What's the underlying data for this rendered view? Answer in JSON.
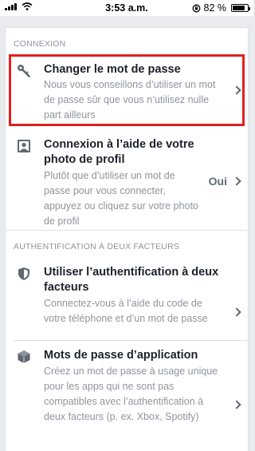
{
  "status_bar": {
    "time": "3:53 a.m.",
    "battery": "82 %",
    "battery_level": 0.82
  },
  "login_section": {
    "header": "CONNEXION",
    "change_password": {
      "title": "Changer le mot de passe",
      "description": "Nous vous conseillons d’utiliser un mot de passe sûr que vous n’utilisez nulle part ailleurs",
      "icon": "key-icon"
    },
    "profile_photo_login": {
      "title": "Connexion à l’aide de votre photo de profil",
      "description": "Plutôt que d’utiliser un mot de passe pour vous connecter, appuyez ou cliquez sur votre photo de profil",
      "value": "Oui",
      "icon": "profile-photo-icon"
    }
  },
  "two_factor_section": {
    "header": "AUTHENTIFICATION À DEUX FACTEURS",
    "use_two_factor": {
      "title": "Utiliser l’authentification à deux facteurs",
      "description": "Connectez-vous à l’aide du code de votre téléphone et d’un mot de passe",
      "icon": "shield-icon"
    },
    "app_passwords": {
      "title": "Mots de passe d’application",
      "description": "Créez un mot de passe à usage unique pour les apps qui ne sont pas compatibles avec l’authentification à deux facteurs (p. ex. Xbox, Spotify)",
      "icon": "cube-icon"
    }
  },
  "colors": {
    "highlight": "#e0201f",
    "background": "#e9ebee",
    "secondary_text": "#90949c"
  }
}
